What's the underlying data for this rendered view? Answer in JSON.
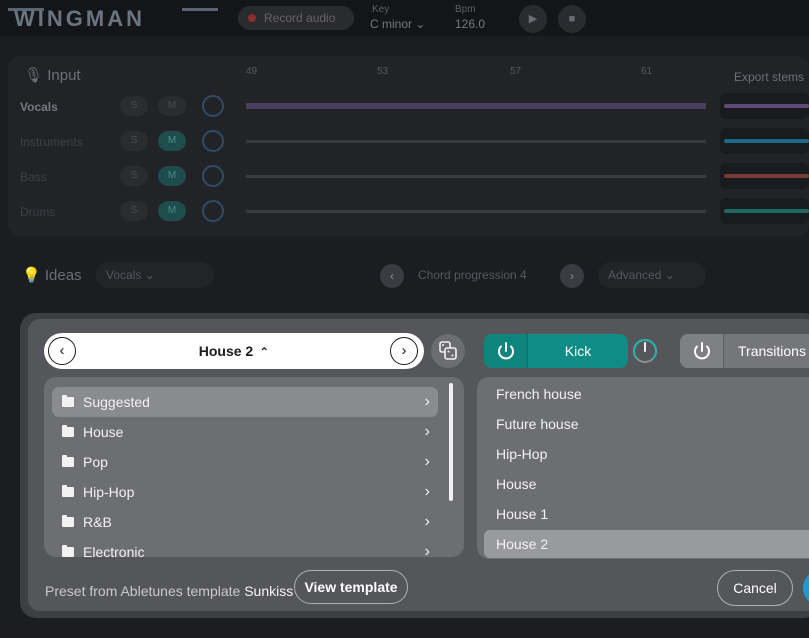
{
  "app": {
    "logo": "WINGMAN",
    "record_label": "Record audio",
    "key_label": "Key",
    "key_value": "C minor",
    "bpm_label": "Bpm",
    "bpm_value": "126.0"
  },
  "input": {
    "title": "Input",
    "bars": [
      "49",
      "53",
      "57",
      "61"
    ],
    "export_label": "Export stems",
    "tracks": [
      {
        "name": "Vocals",
        "s": "S",
        "m": "M",
        "muted": false,
        "stem_color": "#5e4a7a"
      },
      {
        "name": "Instruments",
        "s": "S",
        "m": "M",
        "muted": true,
        "stem_color": "#1d6a86"
      },
      {
        "name": "Bass",
        "s": "S",
        "m": "M",
        "muted": true,
        "stem_color": "#7a3a36"
      },
      {
        "name": "Drums",
        "s": "S",
        "m": "M",
        "muted": true,
        "stem_color": "#1e6a60"
      }
    ]
  },
  "ideas": {
    "title": "Ideas",
    "source": "Vocals",
    "chord_label": "Chord progression 4",
    "advanced_label": "Advanced"
  },
  "modal": {
    "preset_title": "House 2",
    "folders": [
      "Suggested",
      "House",
      "Pop",
      "Hip-Hop",
      "R&B",
      "Electronic"
    ],
    "selected_folder": "Suggested",
    "kick_label": "Kick",
    "transitions_label": "Transitions",
    "presets": [
      "French house",
      "Future house",
      "Hip-Hop",
      "House",
      "House 1",
      "House 2"
    ],
    "selected_preset": "House 2",
    "footer_prefix": "Preset from Abletunes template",
    "footer_template": "Sunkiss",
    "view_template_label": "View template",
    "cancel_label": "Cancel"
  },
  "colors": {
    "accent_teal": "#118b85",
    "accent_blue": "#1d9ad6",
    "modal_bg": "#555659"
  },
  "icons": {
    "prev": "chevron-left-icon",
    "next": "chevron-right-icon",
    "caret": "caret-up-icon",
    "dice": "dice-icon",
    "power": "power-icon",
    "folder": "folder-icon"
  }
}
